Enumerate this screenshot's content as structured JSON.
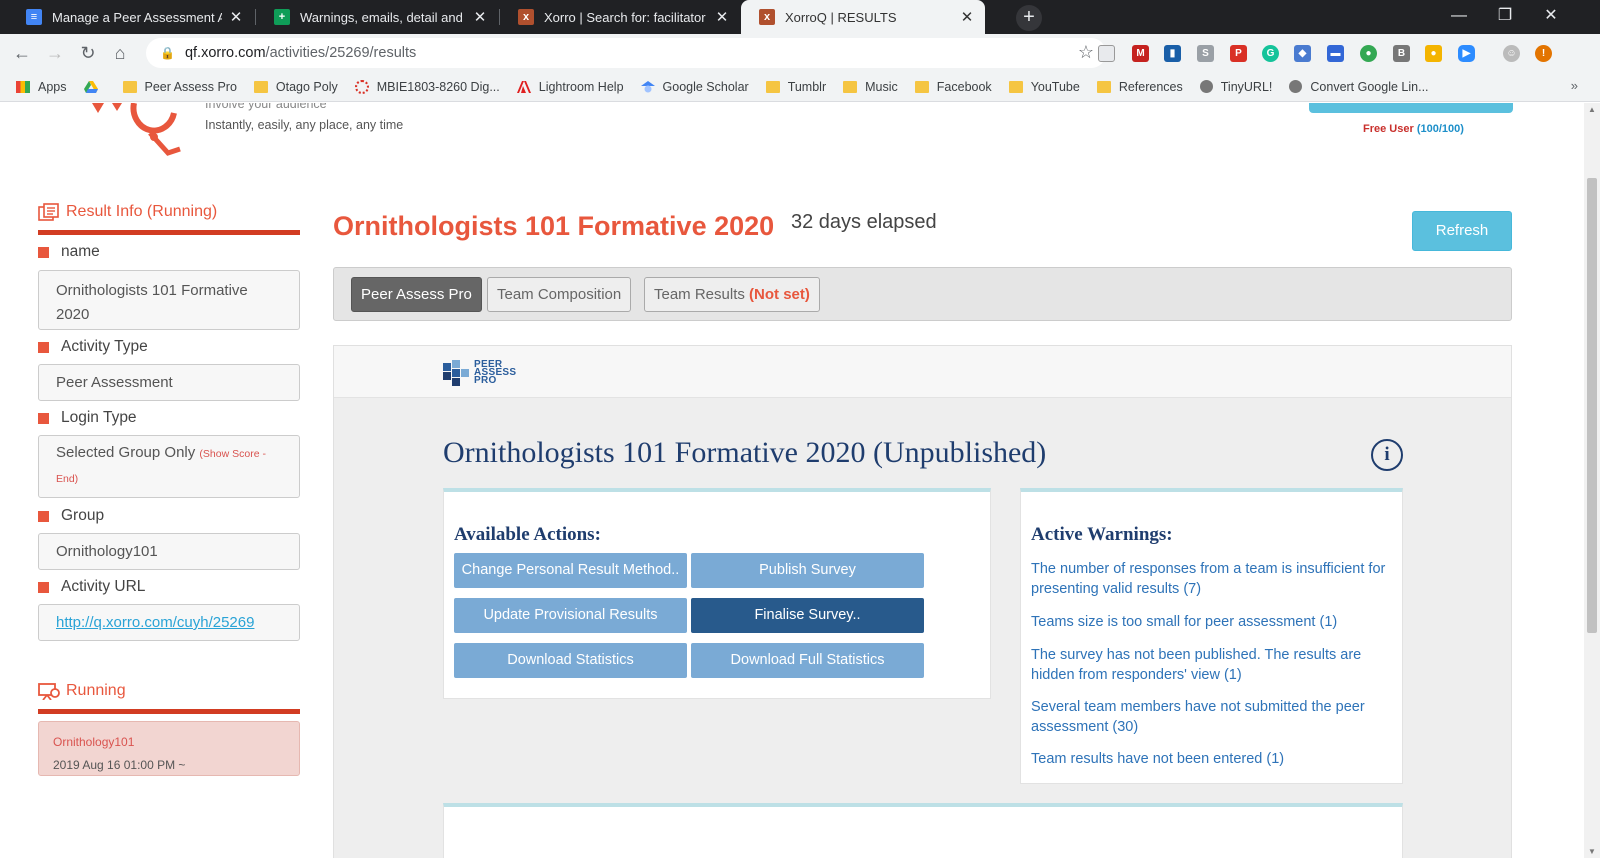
{
  "browser": {
    "tabs": [
      {
        "title": "Manage a Peer Assessment Activ",
        "icon": "google-docs-icon",
        "color": "#4285f4"
      },
      {
        "title": "Warnings, emails, detail and rem",
        "icon": "google-sheets-icon",
        "color": "#0f9d58"
      },
      {
        "title": "Xorro | Search for: facilitator plan",
        "icon": "xorro-icon",
        "color": "#e8573d"
      },
      {
        "title": "XorroQ | RESULTS",
        "icon": "xorro-icon",
        "color": "#e8573d"
      }
    ],
    "url_host": "qf.xorro.com",
    "url_path": "/activities/25269/results",
    "bookmarks": [
      {
        "label": "Apps",
        "icon": "apps-grid-icon"
      },
      {
        "label": "",
        "icon": "google-drive-icon"
      },
      {
        "label": "Peer Assess Pro",
        "icon": "folder-icon"
      },
      {
        "label": "Otago Poly",
        "icon": "folder-icon"
      },
      {
        "label": "MBIE1803-8260 Dig...",
        "icon": "mbie-icon"
      },
      {
        "label": "Lightroom Help",
        "icon": "adobe-icon"
      },
      {
        "label": "Google Scholar",
        "icon": "scholar-icon"
      },
      {
        "label": "Tumblr",
        "icon": "folder-icon"
      },
      {
        "label": "Music",
        "icon": "folder-icon"
      },
      {
        "label": "Facebook",
        "icon": "folder-icon"
      },
      {
        "label": "YouTube",
        "icon": "folder-icon"
      },
      {
        "label": "References",
        "icon": "folder-icon"
      },
      {
        "label": "TinyURL!",
        "icon": "globe-icon"
      },
      {
        "label": "Convert Google Lin...",
        "icon": "globe-icon"
      }
    ],
    "bookmarks_more": "»"
  },
  "header": {
    "tagline_1": "Involve your audience",
    "tagline_2": "Instantly, easily, any place, any time",
    "user_status": "Free User",
    "user_quota": "(100/100)"
  },
  "sidebar": {
    "result_info_heading": "Result Info (Running)",
    "fields": [
      {
        "label": "name",
        "value": "Ornithologists 101 Formative 2020"
      },
      {
        "label": "Activity Type",
        "value": "Peer Assessment"
      },
      {
        "label": "Login Type",
        "value": "Selected Group Only",
        "note": "(Show Score - End)"
      },
      {
        "label": "Group",
        "value": "Ornithology101"
      },
      {
        "label": "Activity URL",
        "value": "http://q.xorro.com/cuyh/25269"
      }
    ],
    "running_heading": "Running",
    "running_group": "Ornithology101",
    "running_date": "2019 Aug 16 01:00 PM ~"
  },
  "main": {
    "title": "Ornithologists 101 Formative 2020",
    "elapsed": "32 days elapsed",
    "refresh_label": "Refresh",
    "tabs": [
      {
        "label": "Peer Assess Pro"
      },
      {
        "label": "Team Composition"
      },
      {
        "label": "Team Results",
        "badge": "(Not set)"
      }
    ],
    "logo_text": [
      "PEER",
      "ASSESS",
      "PRO"
    ],
    "survey_title": "Ornithologists 101 Formative 2020 (Unpublished)",
    "actions_heading": "Available Actions:",
    "actions": [
      "Change Personal Result Method..",
      "Publish Survey",
      "Update Provisional Results",
      "Finalise Survey..",
      "Download Statistics",
      "Download Full Statistics"
    ],
    "warnings_heading": "Active Warnings:",
    "warnings": [
      "The number of responses from a team is insufficient for presenting valid results (7)",
      "Teams size is too small for peer assessment (1)",
      "The survey has not been published. The results are hidden from responders' view (1)",
      "Several team members have not submitted the peer assessment (30)",
      "Team results have not been entered (1)"
    ]
  },
  "colors": {
    "accent": "#e8573d",
    "info_button": "#5bc0de",
    "navy": "#1f3d6e",
    "action_button": "#7aaad5",
    "action_button_dark": "#285a8c",
    "warning_link": "#2e73b8"
  }
}
